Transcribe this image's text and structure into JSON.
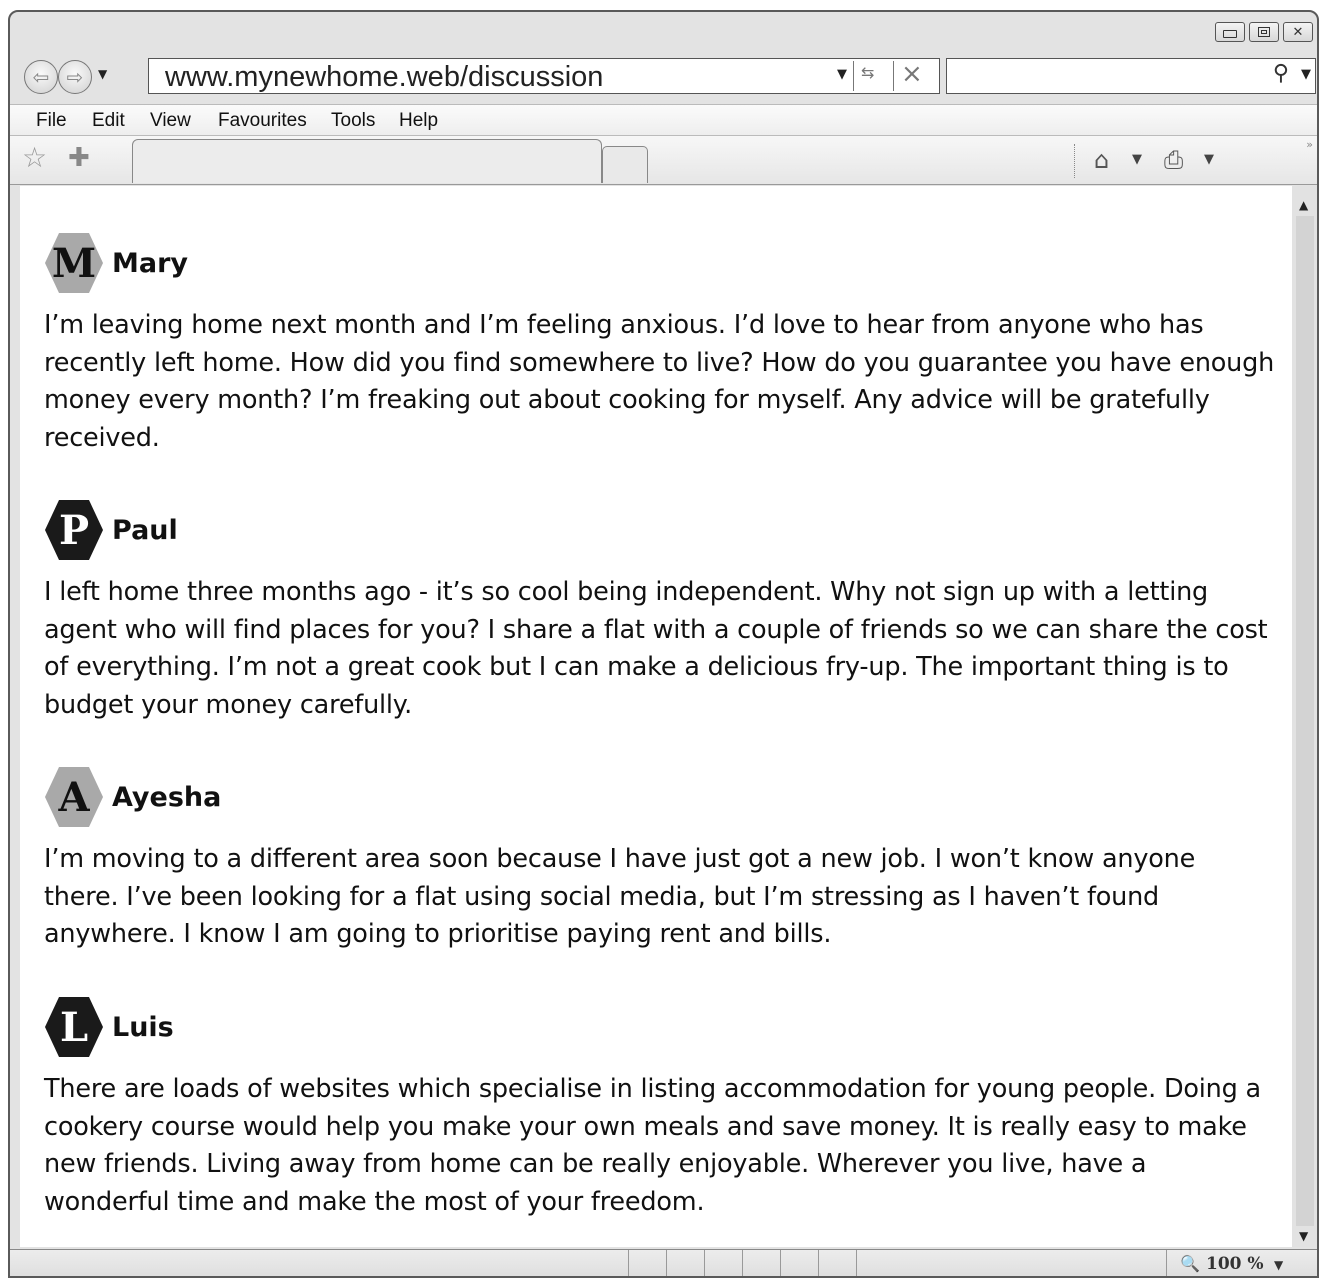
{
  "browser": {
    "address": "www.mynewhome.web/discussion",
    "menu": [
      "File",
      "Edit",
      "View",
      "Favourites",
      "Tools",
      "Help"
    ],
    "zoom": "100 %"
  },
  "posts": [
    {
      "initial": "M",
      "avatar_style": "light",
      "name": "Mary",
      "text": "I’m leaving home next month and I’m feeling anxious. I’d love to hear from anyone who has recently left home. How did you find somewhere to live? How do you guarantee you have enough money every month? I’m freaking out about cooking for myself. Any advice will be gratefully received."
    },
    {
      "initial": "P",
      "avatar_style": "dark",
      "name": "Paul",
      "text": "I left home three months ago - it’s so cool being independent. Why not sign up with a letting agent who will find places for you? I share a flat with a couple of friends so we can share the cost of everything. I’m not a great cook but I can make a delicious fry-up. The important thing is to budget your money carefully."
    },
    {
      "initial": "A",
      "avatar_style": "light",
      "name": "Ayesha",
      "text": "I’m moving to a different area soon because I have just got a new job. I won’t know anyone there. I’ve been looking for a flat using social media, but I’m stressing as I haven’t found anywhere. I know I am going to prioritise paying rent and bills."
    },
    {
      "initial": "L",
      "avatar_style": "dark",
      "name": "Luis",
      "text": "There are loads of websites which specialise in listing accommodation for young people. Doing a cookery course would help you make your own meals and save money. It is really easy to make new friends. Living away from home can be really enjoyable. Wherever you live, have a wonderful time and make the most of your freedom."
    }
  ],
  "colors": {
    "avatar_light": "#a9a9a9",
    "avatar_dark": "#1a1a1a",
    "chrome": "#e3e3e3"
  },
  "icons": [
    "back-arrow-icon",
    "forward-arrow-icon",
    "search-icon",
    "star-icon",
    "add-favorite-icon",
    "home-icon",
    "print-icon",
    "zoom-icon"
  ]
}
